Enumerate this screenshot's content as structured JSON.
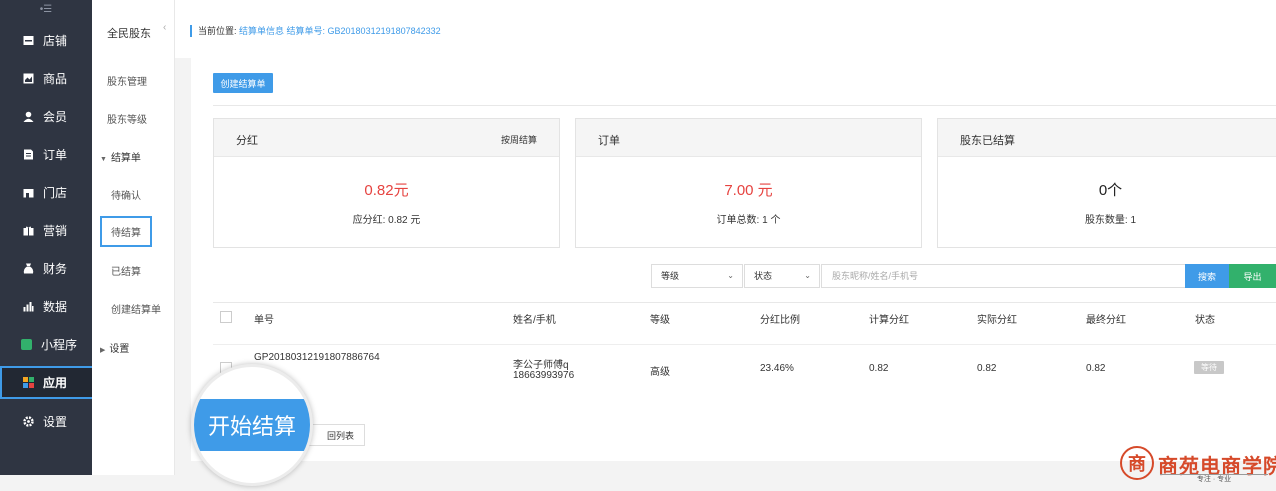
{
  "sidebar": {
    "top_icon": "•☰",
    "items": [
      {
        "label": "店铺",
        "icon": "store-icon"
      },
      {
        "label": "商品",
        "icon": "goods-icon"
      },
      {
        "label": "会员",
        "icon": "member-icon"
      },
      {
        "label": "订单",
        "icon": "order-icon"
      },
      {
        "label": "门店",
        "icon": "shop-icon"
      },
      {
        "label": "营销",
        "icon": "gift-icon"
      },
      {
        "label": "财务",
        "icon": "finance-icon"
      },
      {
        "label": "数据",
        "icon": "chart-icon"
      },
      {
        "label": "小程序",
        "icon": "miniapp-icon"
      },
      {
        "label": "应用",
        "icon": "apps-icon"
      },
      {
        "label": "设置",
        "icon": "gear-icon"
      }
    ]
  },
  "subnav": {
    "title": "全民股东",
    "items": {
      "shareholder_manage": "股东管理",
      "shareholder_level": "股东等级",
      "settlement": "结算单",
      "pending_confirm": "待确认",
      "pending_settle": "待结算",
      "settled": "已结算",
      "create_settlement": "创建结算单",
      "settings": "设置"
    }
  },
  "breadcrumb": {
    "prefix": "当前位置:",
    "path": "结算单信息 结算单号: GB20180312191807842332"
  },
  "toolbar": {
    "create_label": "创建结算单"
  },
  "cards": {
    "dividend": {
      "title": "分红",
      "right": "按周结算",
      "value": "0.82元",
      "sub": "应分红: 0.82 元"
    },
    "orders": {
      "title": "订单",
      "value": "7.00 元",
      "sub": "订单总数: 1 个"
    },
    "settled": {
      "title": "股东已结算",
      "value": "0个",
      "sub": "股东数量: 1"
    }
  },
  "filters": {
    "level": "等级",
    "status": "状态",
    "search_placeholder": "股东昵称/姓名/手机号",
    "search_label": "搜索",
    "export_label": "导出"
  },
  "table": {
    "headers": [
      "单号",
      "姓名/手机",
      "等级",
      "分红比例",
      "计算分红",
      "实际分红",
      "最终分红",
      "状态"
    ],
    "rows": [
      {
        "order_no": "GP20180312191807886764",
        "name": "李公子师傅q",
        "phone": "18663993976",
        "level": "高级",
        "ratio": "23.46%",
        "calc": "0.82",
        "actual": "0.82",
        "final": "0.82",
        "status": "等待"
      }
    ]
  },
  "back_label": "回列表",
  "magnifier_label": "开始结算",
  "logo": {
    "seal": "商",
    "name": "商苑电商学院",
    "tag": "专注 · 专业"
  },
  "colors": {
    "accent": "#3f9be8",
    "green": "#32b16c",
    "red": "#e64340",
    "sidebar_bg": "#2f3542"
  }
}
